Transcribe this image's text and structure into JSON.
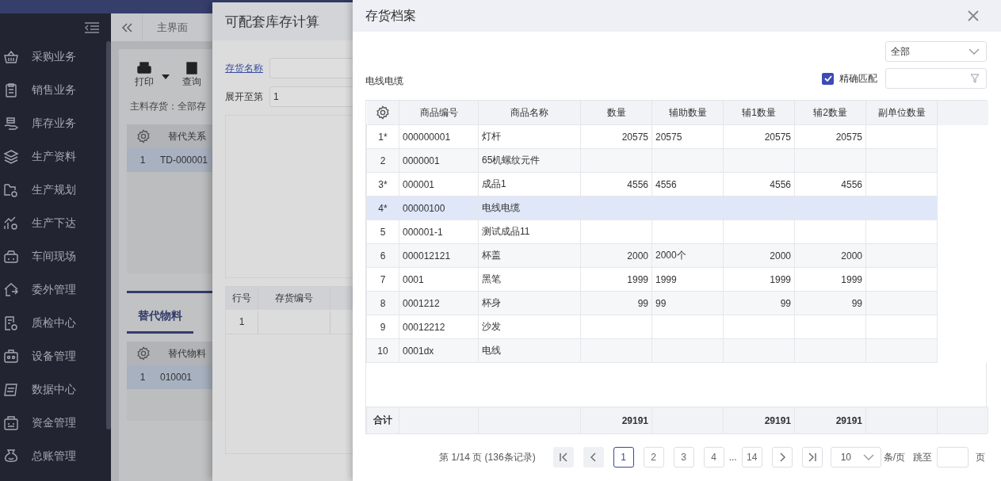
{
  "app": {
    "sidebar": {
      "items": [
        {
          "label": "采购业务"
        },
        {
          "label": "销售业务"
        },
        {
          "label": "库存业务"
        },
        {
          "label": "生产资料"
        },
        {
          "label": "生产规划"
        },
        {
          "label": "生产下达"
        },
        {
          "label": "车间现场"
        },
        {
          "label": "委外管理"
        },
        {
          "label": "质检中心"
        },
        {
          "label": "设备管理"
        },
        {
          "label": "数据中心"
        },
        {
          "label": "资金管理"
        },
        {
          "label": "总账管理"
        }
      ]
    },
    "tabs": [
      {
        "label": "主界面"
      }
    ],
    "toolbar": [
      {
        "label": "打印",
        "kind": "print"
      },
      {
        "label": "查询",
        "kind": "query"
      }
    ],
    "filter_text": "主料存货：全部存",
    "top_table": {
      "columns": [
        "替代关系"
      ],
      "rows": [
        {
          "no": "1",
          "code": "TD-000001"
        }
      ]
    },
    "bottom_tabs": [
      {
        "label": "替代物料",
        "selected": true
      }
    ],
    "bottom_table": {
      "columns": [
        "替代物料"
      ],
      "rows": [
        {
          "no": "1",
          "code": "010001"
        }
      ]
    }
  },
  "calc_dialog": {
    "title": "可配套库存计算",
    "fields": [
      {
        "label": "存货名称",
        "kind": "link"
      },
      {
        "label": "展开至第",
        "kind": "text",
        "value": "1"
      }
    ],
    "table": {
      "columns": [
        "行号",
        "存货编号"
      ],
      "rows": [
        {
          "no": "1"
        }
      ]
    }
  },
  "inventory_dialog": {
    "title": "存货档案",
    "category": "全部",
    "keyword": "电线电缆",
    "exact_match": {
      "label": "精确匹配",
      "checked": true
    },
    "table": {
      "columns": [
        "商品编号",
        "商品名称",
        "数量",
        "辅助数量",
        "辅1数量",
        "辅2数量",
        "副单位数量"
      ],
      "rows": [
        {
          "no": "1*",
          "code": "000000001",
          "name": "灯杆",
          "qty": "20575",
          "aux": "20575",
          "aux1": "20575",
          "aux2": "20575",
          "selected": false
        },
        {
          "no": "2",
          "code": "0000001",
          "name": "65机螺纹元件",
          "selected": false
        },
        {
          "no": "3*",
          "code": "000001",
          "name": "成品1",
          "qty": "4556",
          "aux": "4556",
          "aux1": "4556",
          "aux2": "4556",
          "selected": false
        },
        {
          "no": "4*",
          "code": "00000100",
          "name": "电线电缆",
          "selected": true
        },
        {
          "no": "5",
          "code": "000001-1",
          "name": "测试成品11",
          "selected": false
        },
        {
          "no": "6",
          "code": "000012121",
          "name": "杯盖",
          "qty": "2000",
          "aux": "2000个",
          "aux1": "2000",
          "aux2": "2000",
          "selected": false
        },
        {
          "no": "7",
          "code": "0001",
          "name": "黑笔",
          "qty": "1999",
          "aux": "1999",
          "aux1": "1999",
          "aux2": "1999",
          "selected": false
        },
        {
          "no": "8",
          "code": "0001212",
          "name": "杯身",
          "qty": "99",
          "aux": "99",
          "aux1": "99",
          "aux2": "99",
          "selected": false
        },
        {
          "no": "9",
          "code": "00012212",
          "name": "沙发",
          "selected": false
        },
        {
          "no": "10",
          "code": "0001dx",
          "name": "电线",
          "selected": false
        }
      ],
      "total": {
        "label": "合计",
        "qty": "29191",
        "aux1": "29191",
        "aux2": "29191"
      }
    },
    "pagination": {
      "summary": "第 1/14 页 (136条记录)",
      "buttons": [
        {
          "kind": "first",
          "disabled": true
        },
        {
          "kind": "prev",
          "disabled": true
        },
        {
          "kind": "page",
          "label": "1",
          "selected": true
        },
        {
          "kind": "page",
          "label": "2",
          "selected": false
        },
        {
          "kind": "page",
          "label": "3",
          "selected": false
        },
        {
          "kind": "page",
          "label": "4",
          "selected": false
        },
        {
          "kind": "ellipsis",
          "label": "..."
        },
        {
          "kind": "page",
          "label": "14",
          "selected": false
        },
        {
          "kind": "next",
          "disabled": false
        },
        {
          "kind": "last",
          "disabled": false
        }
      ],
      "page_size": "10",
      "page_size_unit": "条/页",
      "jump_label": "跳至",
      "jump_unit": "页"
    }
  }
}
